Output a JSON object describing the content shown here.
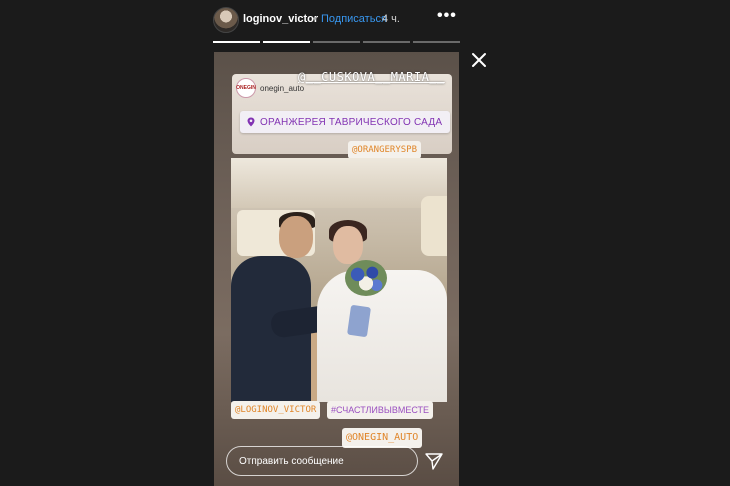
{
  "header": {
    "username": "loginov_victor",
    "separator": "•",
    "follow_label": "Подписаться",
    "time": "4 ч.",
    "more_icon": "more-horizontal-icon"
  },
  "progress": {
    "segments": 5,
    "completed": 2
  },
  "close_icon": "close-icon",
  "story": {
    "brand_account": "onegin_auto",
    "brand_logo_text": "ONEGIN",
    "mention_top": "@__CUSKOVA__MARIA__",
    "location_label": "ОРАНЖЕРЕЯ ТАВРИЧЕСКОГО САДА",
    "tag_orangery": "@ORANGERYSPB",
    "tag_loginov": "@LOGINOV_VICTOR",
    "hashtag": "#СЧАСТЛИВЫВМЕСТЕ",
    "tag_onegin": "@ONEGIN_AUTO"
  },
  "reply": {
    "placeholder": "Отправить сообщение",
    "send_icon": "send-icon"
  },
  "colors": {
    "follow": "#3897f0",
    "location_text": "#8233b3",
    "tag_orange": "#e0862a",
    "hashtag_purple": "#9a4fc0"
  }
}
